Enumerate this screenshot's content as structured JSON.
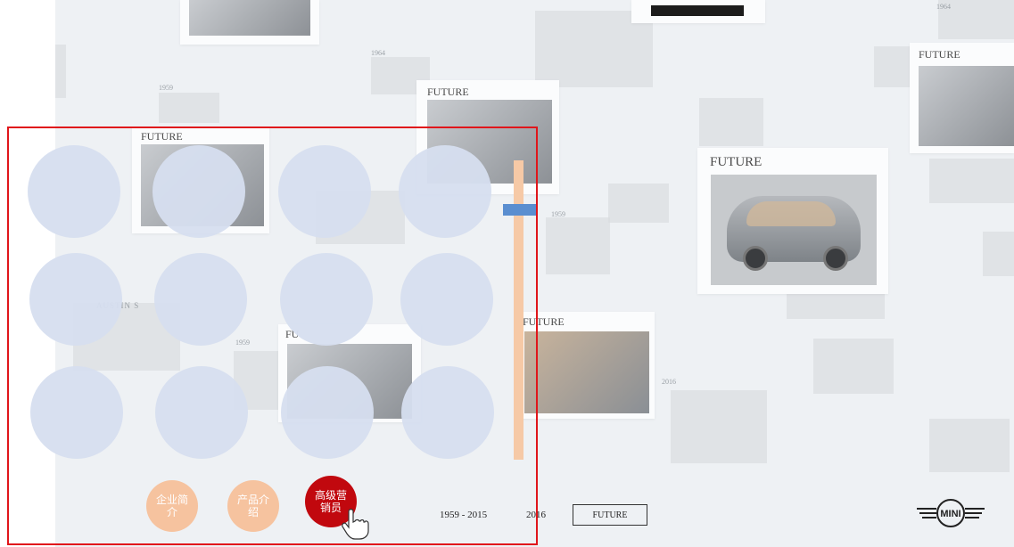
{
  "collage": {
    "card_labels": [
      "FUTURE",
      "FUTURE",
      "FUTURE",
      "FUTURE",
      "FUTURE",
      "FU"
    ],
    "year_labels": [
      "1959",
      "1964",
      "1959",
      "1959",
      "2016",
      "1964"
    ],
    "faded_caption": "AUSTIN S"
  },
  "nav": {
    "company_intro": "企业简介",
    "product_intro": "产品介绍",
    "senior_sales": "高级营销员"
  },
  "timeline": {
    "range_label": "1959 - 2015",
    "year_label": "2016",
    "future_label": "FUTURE"
  },
  "brand": {
    "logo_text": "MINI"
  },
  "colors": {
    "frame": "#e0161b",
    "circle": "#d6deef",
    "slider_track": "#f6c9a6",
    "slider_thumb": "#5a8ed0",
    "nav_peach": "#f6c39f",
    "nav_active": "#c1080e"
  },
  "slider": {
    "level_fraction": 0.15
  }
}
